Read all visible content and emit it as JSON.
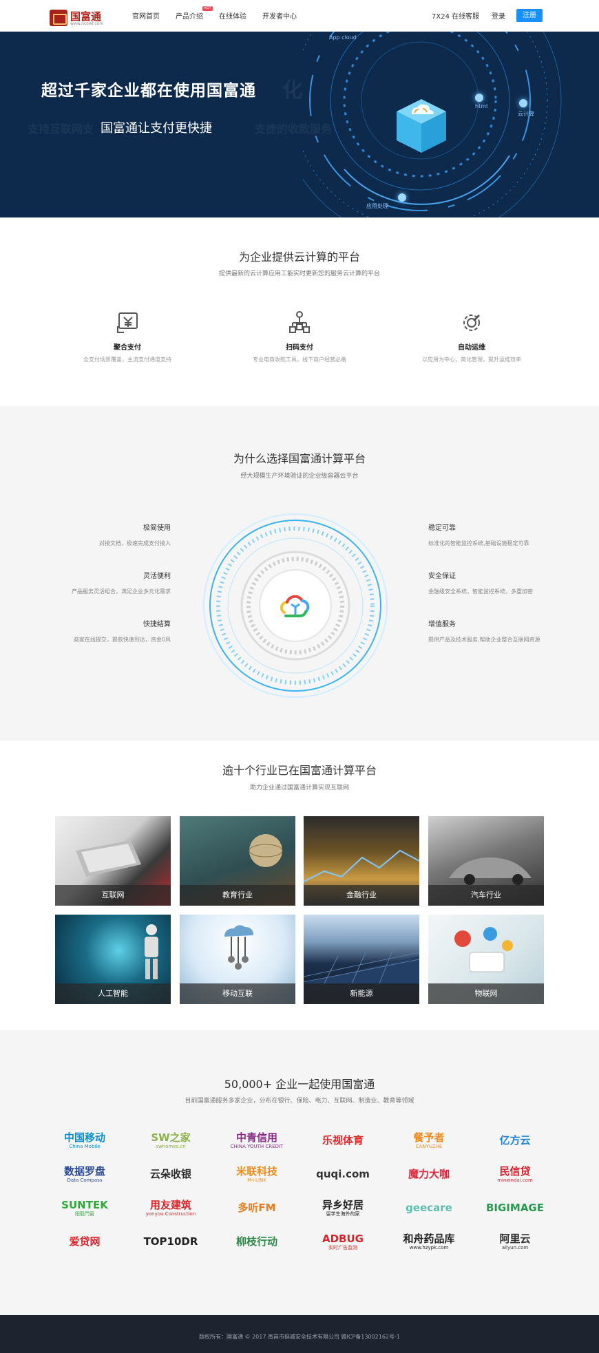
{
  "header": {
    "logo_text": "国富通",
    "logo_sub": "www.ncowf.com",
    "nav": [
      "官网首页",
      "产品介绍",
      "在线体验",
      "开发者中心"
    ],
    "hot_badge": "HOT",
    "service": "7X24 在线客服",
    "login": "登录",
    "register": "注册"
  },
  "banner": {
    "title": "超过千家企业都在使用国富通",
    "subtitle": "国富通让支付更快捷",
    "ghost_title": "化",
    "ghost_sub_left": "支持互联网支",
    "ghost_sub_right": "支捷的收款服务",
    "orbit_labels": [
      "App cloud",
      "html",
      "云计算",
      "应用处理"
    ]
  },
  "platform": {
    "title": "为企业提供云计算的平台",
    "subtitle": "提供最新的云计算应用工能实时更新您的服务云计算的平台",
    "features": [
      {
        "name": "聚合支付",
        "desc": "全支付场景覆盖，主流支付通道支持",
        "icon": "yen-icon"
      },
      {
        "name": "扫码支付",
        "desc": "专业电商收款工具，线下商户经营必备",
        "icon": "qr-flow-icon"
      },
      {
        "name": "自动运维",
        "desc": "以应用为中心，简化管理，提升运维效率",
        "icon": "gear-wrench-icon"
      }
    ]
  },
  "why": {
    "title": "为什么选择国富通计算平台",
    "subtitle": "经大规模生产环境验证的企业级容器云平台",
    "left": [
      {
        "t": "极简使用",
        "d": "对接文档，极速完成支付接入"
      },
      {
        "t": "灵活便利",
        "d": "产品服务灵活组合，满足企业多元化需求"
      },
      {
        "t": "快捷结算",
        "d": "商家在线提交，提款快速到达，资金0风"
      }
    ],
    "right": [
      {
        "t": "稳定可靠",
        "d": "标准化的智能监控系统,基础设施稳定可靠"
      },
      {
        "t": "安全保证",
        "d": "金融级安全系统，智能监控系统，多重加密"
      },
      {
        "t": "增值服务",
        "d": "提供产品及技术服务,帮助企业整合互联网资源"
      }
    ]
  },
  "industries": {
    "title": "逾十个行业已在国富通计算平台",
    "subtitle": "助力企业通过国富通计算实现互联网",
    "items": [
      "互联网",
      "教育行业",
      "金融行业",
      "汽车行业",
      "人工智能",
      "移动互联",
      "新能源",
      "物联网"
    ]
  },
  "partners": {
    "title": "50,000+ 企业一起使用国富通",
    "subtitle": "目前国富通服务多家企业，分布在银行、保险、电力、互联网、制造业、教育等领域",
    "logos": [
      {
        "name": "中国移动",
        "sub": "China Mobile",
        "color": "#0b8ed2"
      },
      {
        "name": "SW之家",
        "sub": "swhomes.cn",
        "color": "#8db04a"
      },
      {
        "name": "中青信用",
        "sub": "CHINA YOUTH CREDIT",
        "color": "#8a2a86"
      },
      {
        "name": "乐视体育",
        "sub": "",
        "color": "#e22828"
      },
      {
        "name": "餐予者",
        "sub": "CANYUZHE",
        "color": "#f08a1c"
      },
      {
        "name": "亿方云",
        "sub": "",
        "color": "#1f86e0"
      },
      {
        "name": "数据罗盘",
        "sub": "Data Compass",
        "color": "#2a4a9b"
      },
      {
        "name": "云朵收银",
        "sub": "",
        "color": "#2d2d2d"
      },
      {
        "name": "米联科技",
        "sub": "M+LINK",
        "color": "#f08c1a"
      },
      {
        "name": "quqi.com",
        "sub": "",
        "color": "#333333"
      },
      {
        "name": "魔力大咖",
        "sub": "",
        "color": "#e0243a"
      },
      {
        "name": "民信贷",
        "sub": "minxindai.com",
        "color": "#d81e2c"
      },
      {
        "name": "SUNTEK",
        "sub": "阳毅門窗",
        "color": "#2caa3a"
      },
      {
        "name": "用友建筑",
        "sub": "yonyou Construction",
        "color": "#d8262a"
      },
      {
        "name": "多听FM",
        "sub": "",
        "color": "#f07a1a"
      },
      {
        "name": "异乡好居",
        "sub": "留学生海外的家",
        "color": "#222222"
      },
      {
        "name": "geecare",
        "sub": "",
        "color": "#5bbfae"
      },
      {
        "name": "BIGIMAGE",
        "sub": "",
        "color": "#2a9a52"
      },
      {
        "name": "爱贷网",
        "sub": "",
        "color": "#e2222a"
      },
      {
        "name": "TOP10DR",
        "sub": "",
        "color": "#222222"
      },
      {
        "name": "柳枝行动",
        "sub": "",
        "color": "#2f8a4a"
      },
      {
        "name": "ADBUG",
        "sub": "实时广告监测",
        "color": "#d6262a"
      },
      {
        "name": "和舟药品库",
        "sub": "www.hzypk.com",
        "color": "#222222"
      },
      {
        "name": "阿里云",
        "sub": "aliyun.com",
        "color": "#333333"
      }
    ]
  },
  "footer": {
    "text": "版权所有：国富通 © 2017 南昌市挺威安全技术有限公司 赣ICP备13002162号-1"
  }
}
